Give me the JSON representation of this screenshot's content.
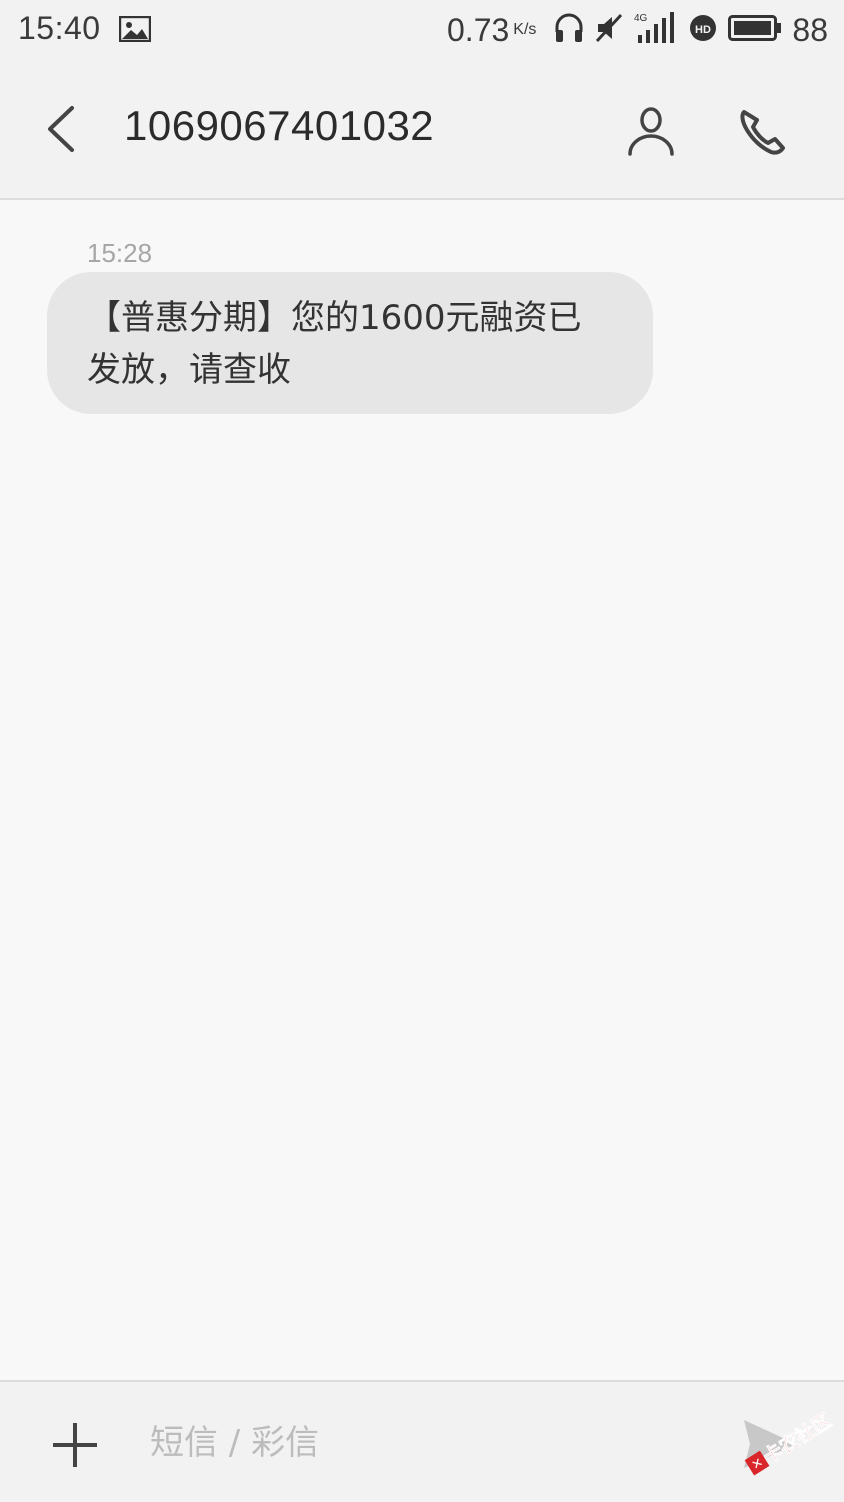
{
  "status_bar": {
    "time": "15:40",
    "network_speed": "0.73",
    "network_speed_unit": "K/s",
    "battery_percent": "88",
    "icons": [
      "gallery-icon",
      "headphones-icon",
      "mute-icon",
      "signal-4g-icon",
      "hd-icon",
      "battery-icon"
    ]
  },
  "header": {
    "title": "1069067401032",
    "icons": [
      "back-icon",
      "contact-icon",
      "phone-icon"
    ]
  },
  "messages": [
    {
      "time": "15:28",
      "text": "【普惠分期】您的1600元融资已发放，请查收"
    }
  ],
  "compose": {
    "placeholder": "短信 / 彩信",
    "icons": [
      "plus-icon",
      "send-icon"
    ]
  },
  "watermark": {
    "text": "卡农社区"
  },
  "colors": {
    "bar_background": "#f2f2f2",
    "page_background": "#f8f8f8",
    "bubble_background": "#e6e6e6",
    "watermark_red": "#d8262b"
  }
}
